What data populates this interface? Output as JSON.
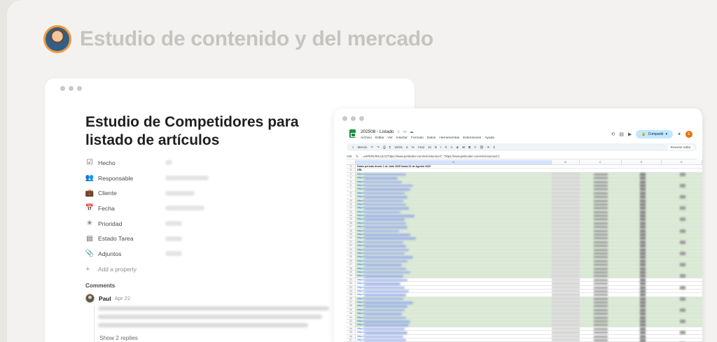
{
  "hero": {
    "title": "Estudio de contenido y del mercado"
  },
  "notion": {
    "title": "Estudio de Competidores para listado de artículos",
    "properties": [
      {
        "label": "Hecho",
        "icon": "checkbox-icon",
        "glyph": "☑"
      },
      {
        "label": "Responsable",
        "icon": "people-icon",
        "glyph": "👥"
      },
      {
        "label": "Cliente",
        "icon": "briefcase-icon",
        "glyph": "💼"
      },
      {
        "label": "Fecha",
        "icon": "calendar-icon",
        "glyph": "📅"
      },
      {
        "label": "Prioridad",
        "icon": "spinner-icon",
        "glyph": "✳"
      },
      {
        "label": "Estado Tarea",
        "icon": "chart-icon",
        "glyph": "▤"
      },
      {
        "label": "Adjuntos",
        "icon": "paperclip-icon",
        "glyph": "📎"
      }
    ],
    "add_property": "Add a property",
    "comments_heading": "Comments",
    "comment": {
      "author": "Paul",
      "date": "Apr 22"
    },
    "show_replies": "Show 2 replies"
  },
  "sheets": {
    "doc_name": "202508 - Listado",
    "menu": [
      "Archivo",
      "Editar",
      "Ver",
      "Insertar",
      "Formato",
      "Datos",
      "Herramientas",
      "Extensiones",
      "Ayuda"
    ],
    "share_label": "Compartir",
    "user_initial": "E",
    "toolbar": {
      "search": "Menús",
      "zoom": "100%",
      "currency": "€",
      "percent": "%",
      "font": "Arial",
      "font_size": "10",
      "summarize": "Resumir tabla"
    },
    "formula": {
      "cell_ref": "A29",
      "content": "=HIPERVINCULO(\"https://www.petitcolier.com/es/cinturones\"; \"https://www.petitcolier.com/es/cinturones\")"
    },
    "columns": [
      "A",
      "B",
      "C",
      "D",
      "E"
    ],
    "header_row": "Datos período desde 1 de Julio 2025 hasta 31 de Agosto 2025",
    "url_header": "URL",
    "url_prefix": "https://",
    "row_count": 48
  }
}
